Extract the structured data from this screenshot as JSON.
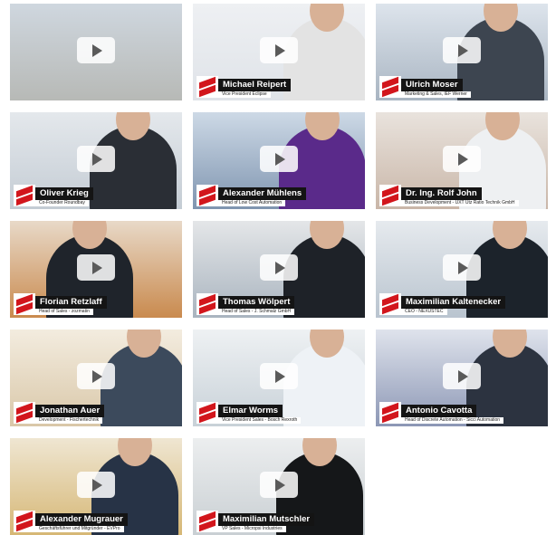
{
  "videos": [
    {
      "name": "",
      "role": "",
      "colors": {
        "bg1": "#cfd7df",
        "bg2": "#b7b9b6",
        "shirt": "#7d8a96"
      }
    },
    {
      "name": "Michael Reipert",
      "role": "Vice President Eclipse",
      "colors": {
        "bg1": "#eef0f3",
        "bg2": "#dfe3e8",
        "shirt": "#e3e3e3"
      }
    },
    {
      "name": "Ulrich Moser",
      "role": "Marketing & Sales, IEF Werner",
      "colors": {
        "bg1": "#dde4ec",
        "bg2": "#a9b5c2",
        "shirt": "#3d4550"
      }
    },
    {
      "name": "Oliver Krieg",
      "role": "Co-Founder Roundbay",
      "colors": {
        "bg1": "#e4e8ec",
        "bg2": "#c4ccd4",
        "shirt": "#2a2e35"
      }
    },
    {
      "name": "Alexander Mühlens",
      "role": "Head of Low Cost Automation",
      "colors": {
        "bg1": "#cdd9e6",
        "bg2": "#7f95b0",
        "shirt": "#5a2a8a"
      }
    },
    {
      "name": "Dr. Ing. Rolf John",
      "role": "Business Development - UXT Utz Ratio Technik GmbH",
      "colors": {
        "bg1": "#e9e3dd",
        "bg2": "#c9b6a8",
        "shirt": "#eef0f2"
      }
    },
    {
      "name": "Florian Retzlaff",
      "role": "Head of Sales - zozmatin",
      "colors": {
        "bg1": "#e8d9c8",
        "bg2": "#c98a4e",
        "shirt": "#1f242b"
      }
    },
    {
      "name": "Thomas Wölpert",
      "role": "Head of Sales - J. Schmalz GmbH",
      "colors": {
        "bg1": "#e4e6e8",
        "bg2": "#a9b4bf",
        "shirt": "#1e2228"
      }
    },
    {
      "name": "Maximilian Kaltenecker",
      "role": "CEO - NEXUSTEC",
      "colors": {
        "bg1": "#e6eaee",
        "bg2": "#b9c4cf",
        "shirt": "#1c232b"
      }
    },
    {
      "name": "Jonathan Auer",
      "role": "Development - Fischertechnik",
      "colors": {
        "bg1": "#f3ecdf",
        "bg2": "#d9c7a8",
        "shirt": "#3c4a5c"
      }
    },
    {
      "name": "Elmar Worms",
      "role": "Vice President Sales - Bosch Rexroth",
      "colors": {
        "bg1": "#eef1f3",
        "bg2": "#c8d1d8",
        "shirt": "#eef2f6"
      }
    },
    {
      "name": "Antonio Cavotta",
      "role": "Head of Discrete Automation - Sicci Automation",
      "colors": {
        "bg1": "#dfe3ec",
        "bg2": "#8c97b5",
        "shirt": "#2c3340"
      }
    },
    {
      "name": "Alexander Mugrauer",
      "role": "Geschäftsführer und Mitgründer - EVPro",
      "colors": {
        "bg1": "#efe6d2",
        "bg2": "#d6b775",
        "shirt": "#273346"
      }
    },
    {
      "name": "Maximilian Mutschler",
      "role": "VP Sales - Micropsi Industries",
      "colors": {
        "bg1": "#eceeef",
        "bg2": "#c9cfd3",
        "shirt": "#151719"
      }
    }
  ]
}
